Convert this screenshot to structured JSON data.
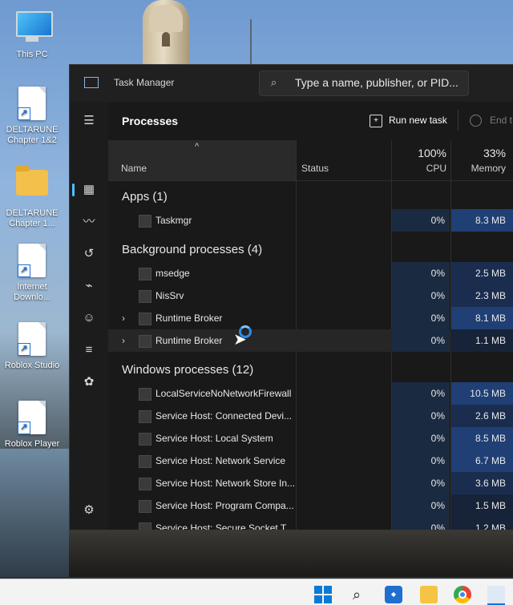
{
  "desktop": {
    "icons": [
      {
        "label": "This PC"
      },
      {
        "label": "DELTARUNE Chapter 1&2"
      },
      {
        "label": "DELTARUNE Chapter 1..."
      },
      {
        "label": "Internet Downlo..."
      },
      {
        "label": "Roblox Studio"
      },
      {
        "label": "Roblox Player"
      }
    ]
  },
  "window": {
    "title": "Task Manager",
    "search_placeholder": "Type a name, publisher, or PID..."
  },
  "toolbar": {
    "page_title": "Processes",
    "run_new_task": "Run new task",
    "end_task": "End t"
  },
  "columns": {
    "name": "Name",
    "status": "Status",
    "cpu_total": "100%",
    "cpu": "CPU",
    "memory_total": "33%",
    "memory": "Memory"
  },
  "groups": {
    "apps": "Apps (1)",
    "background": "Background processes (4)",
    "windows": "Windows processes (12)"
  },
  "rows": {
    "apps": [
      {
        "name": "Taskmgr",
        "cpu": "0%",
        "memory": "8.3 MB"
      }
    ],
    "background": [
      {
        "name": "msedge",
        "cpu": "0%",
        "memory": "2.5 MB"
      },
      {
        "name": "NisSrv",
        "cpu": "0%",
        "memory": "2.3 MB"
      },
      {
        "name": "Runtime Broker",
        "cpu": "0%",
        "memory": "8.1 MB"
      },
      {
        "name": "Runtime Broker",
        "cpu": "0%",
        "memory": "1.1 MB"
      }
    ],
    "windows": [
      {
        "name": "LocalServiceNoNetworkFirewall",
        "cpu": "0%",
        "memory": "10.5 MB"
      },
      {
        "name": "Service Host: Connected Devi...",
        "cpu": "0%",
        "memory": "2.6 MB"
      },
      {
        "name": "Service Host: Local System",
        "cpu": "0%",
        "memory": "8.5 MB"
      },
      {
        "name": "Service Host: Network Service",
        "cpu": "0%",
        "memory": "6.7 MB"
      },
      {
        "name": "Service Host: Network Store In...",
        "cpu": "0%",
        "memory": "3.6 MB"
      },
      {
        "name": "Service Host: Program Compa...",
        "cpu": "0%",
        "memory": "1.5 MB"
      },
      {
        "name": "Service Host: Secure Socket T...",
        "cpu": "0%",
        "memory": "1.2 MB"
      }
    ]
  },
  "colors": {
    "accent": "#4cc2ff",
    "mem_high": "#1f3f75",
    "mem_mid": "#1a2d4f",
    "mem_low": "#162338",
    "cpu_bg": "#1a2a40"
  },
  "icons": {
    "nav": [
      "hamburger-icon",
      "processes-icon",
      "performance-icon",
      "app-history-icon",
      "startup-apps-icon",
      "users-icon",
      "details-icon",
      "services-icon",
      "settings-icon"
    ],
    "taskbar": [
      "windows-logo-icon",
      "search-icon",
      "store-icon",
      "file-explorer-icon",
      "chrome-icon",
      "task-manager-icon"
    ]
  }
}
